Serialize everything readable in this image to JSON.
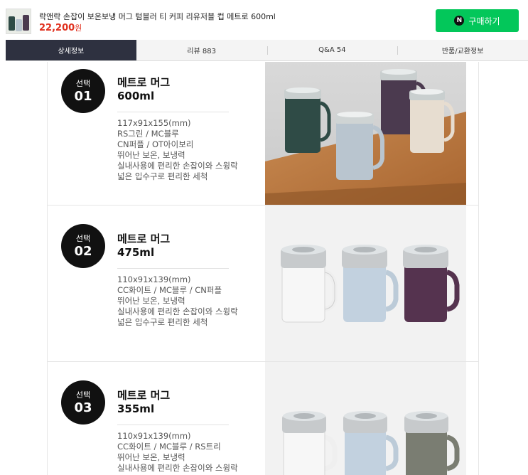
{
  "product": {
    "title": "락앤락 손잡이 보온보냉 머그 텀블러 티 커피 리유저블 컵 메트로 600ml",
    "price": "22,200",
    "currency": "원",
    "buy_label": "구매하기",
    "buy_logo": "N"
  },
  "tabs": [
    {
      "label": "상세정보",
      "active": true
    },
    {
      "label": "리뷰 883",
      "active": false
    },
    {
      "label": "Q&A 54",
      "active": false
    },
    {
      "label": "반품/교환정보",
      "active": false
    }
  ],
  "options": [
    {
      "badge_top": "선택",
      "badge_num": "01",
      "name": "메트로 머그",
      "size": "600ml",
      "details": [
        "117x91x155(mm)",
        "RS그린 / MC블루",
        "CN퍼플 / OT아이보리",
        "뛰어난 보온, 보냉력",
        "실내사용에 편리한 손잡이와 스윙락",
        "넓은 입수구로 편리한 세척"
      ]
    },
    {
      "badge_top": "선택",
      "badge_num": "02",
      "name": "메트로 머그",
      "size": "475ml",
      "details": [
        "110x91x139(mm)",
        "CC화이트 / MC블루 / CN퍼플",
        "뛰어난 보온, 보냉력",
        "실내사용에 편리한 손잡이와 스윙락",
        "넓은 입수구로 편리한 세척"
      ]
    },
    {
      "badge_top": "선택",
      "badge_num": "03",
      "name": "메트로 머그",
      "size": "355ml",
      "details": [
        "110x91x139(mm)",
        "CC화이트 / MC블루 / RS트리",
        "뛰어난 보온, 보냉력",
        "실내사용에 편리한 손잡이와 스윙락"
      ]
    }
  ],
  "colors": {
    "buy_green": "#03c75a",
    "price_red": "#e0301e",
    "active_tab": "#2e3140",
    "mug_green": "#2f4b46",
    "mug_blue": "#b9c5cf",
    "mug_purple": "#4b3a4f",
    "mug_ivory": "#e7ddd0",
    "mug_white": "#f2f2f2",
    "mug_gray": "#7a7d72"
  }
}
